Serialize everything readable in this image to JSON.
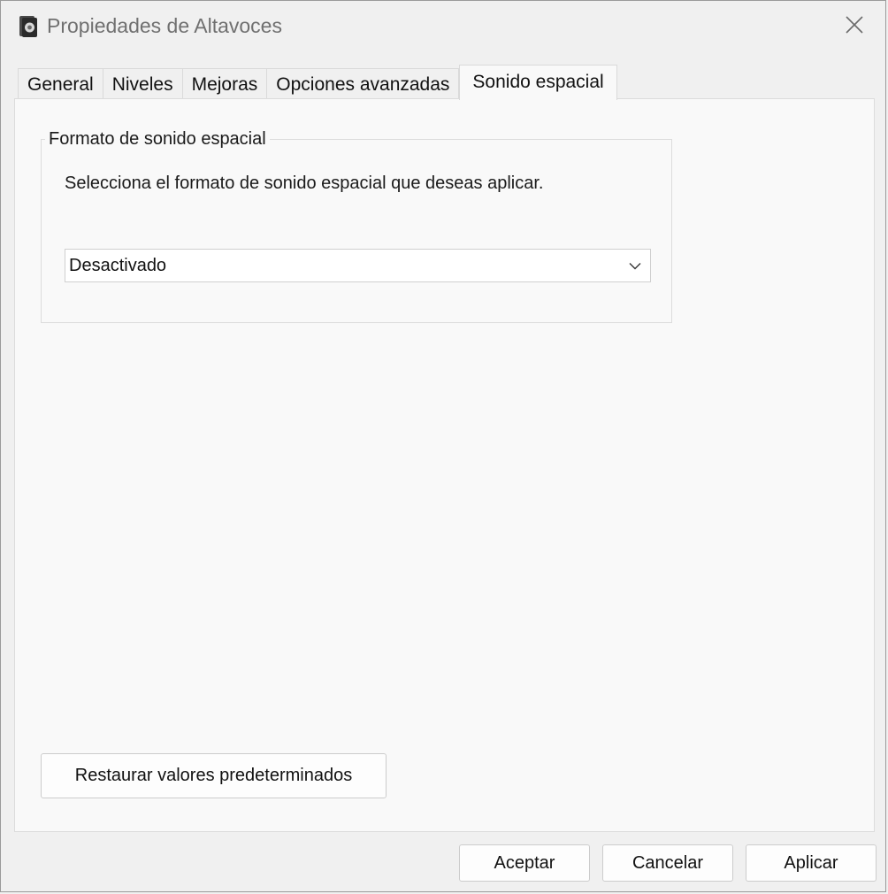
{
  "window": {
    "title": "Propiedades de Altavoces",
    "app_icon": "speaker-icon",
    "close_icon": "close-icon"
  },
  "tabs": [
    {
      "label": "General",
      "active": false
    },
    {
      "label": "Niveles",
      "active": false
    },
    {
      "label": "Mejoras",
      "active": false
    },
    {
      "label": "Opciones avanzadas",
      "active": false
    },
    {
      "label": "Sonido espacial",
      "active": true
    }
  ],
  "spatial": {
    "group_title": "Formato de sonido espacial",
    "description": "Selecciona el formato de sonido espacial que deseas aplicar.",
    "format_value": "Desactivado",
    "chevron_icon": "chevron-down-icon",
    "restore_label": "Restaurar valores predeterminados"
  },
  "footer": {
    "ok_label": "Aceptar",
    "cancel_label": "Cancelar",
    "apply_label": "Aplicar"
  }
}
